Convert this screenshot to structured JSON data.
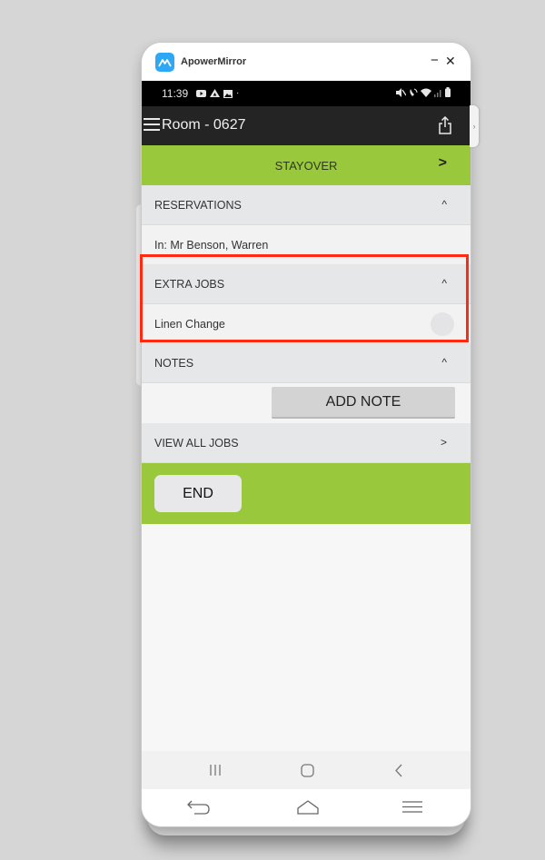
{
  "window": {
    "app_name": "ApowerMirror",
    "minimize_label": "−",
    "close_label": "✕"
  },
  "statusbar": {
    "time": "11:39",
    "left_icons": [
      "youtube-icon",
      "drive-icon",
      "image-icon",
      "dot-icon"
    ],
    "right_icons": [
      "mute-icon",
      "wifi-call-icon",
      "wifi-icon",
      "signal-icon",
      "battery-icon"
    ]
  },
  "appbar": {
    "title": "Room - 0627",
    "menu_icon": "hamburger-icon",
    "share_icon": "share-icon"
  },
  "status_row": {
    "label": "STAYOVER",
    "chevron": ">"
  },
  "sections": {
    "reservations": {
      "label": "RESERVATIONS",
      "chevron": "^",
      "guest": "In: Mr Benson, Warren"
    },
    "extra_jobs": {
      "label": "EXTRA JOBS",
      "chevron": "^",
      "items": [
        {
          "label": "Linen Change",
          "checked": false
        }
      ]
    },
    "notes": {
      "label": "NOTES",
      "chevron": "^",
      "add_note_label": "ADD NOTE"
    },
    "view_all_jobs": {
      "label": "VIEW ALL JOBS",
      "chevron": ">"
    }
  },
  "end_button": {
    "label": "END"
  },
  "android_nav": {
    "recent_icon": "recent-apps-icon",
    "home_icon": "home-icon",
    "back_icon": "back-icon"
  },
  "mirror_nav": {
    "back_icon": "return-icon",
    "home_icon": "home-outline-icon",
    "menu_icon": "menu-icon"
  },
  "colors": {
    "accent_green": "#99c83c",
    "highlight_red": "#ff2a12",
    "appbar_dark": "#242424",
    "logo_blue": "#2ea8f5"
  }
}
